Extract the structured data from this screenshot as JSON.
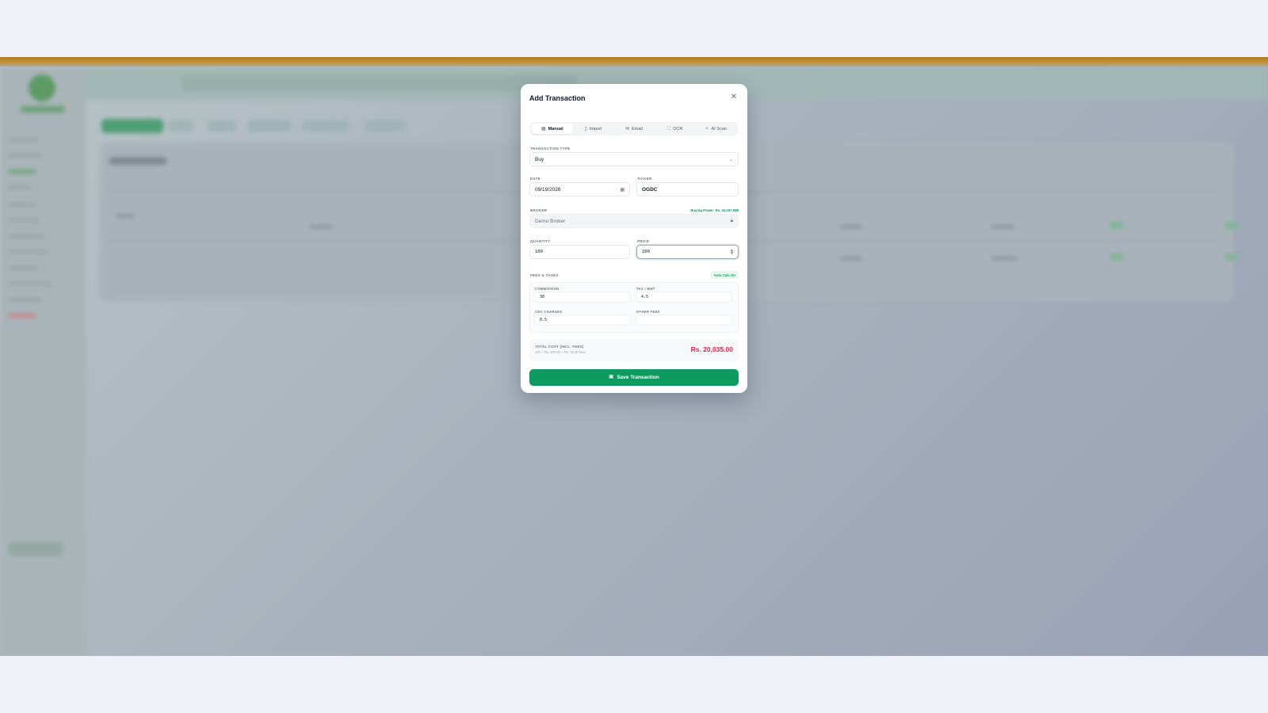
{
  "modal": {
    "title": "Add Transaction",
    "close_icon": "close-icon"
  },
  "tabs": [
    {
      "label": "Manual",
      "icon": "table-icon",
      "active": true
    },
    {
      "label": "Import",
      "icon": "file-icon",
      "active": false
    },
    {
      "label": "Email",
      "icon": "mail-icon",
      "active": false
    },
    {
      "label": "OCR",
      "icon": "scan-icon",
      "active": false
    },
    {
      "label": "AI Scan",
      "icon": "sparkle-icon",
      "active": false
    }
  ],
  "form": {
    "transaction_type": {
      "label": "TRANSACTION TYPE",
      "value": "Buy"
    },
    "date": {
      "label": "DATE",
      "value": "09/19/2026"
    },
    "ticker": {
      "label": "TICKER",
      "value": "OGDC"
    },
    "broker": {
      "label": "BROKER",
      "value": "Demo Broker",
      "buying_power": "Buying Power: Rs. 34,197,988"
    },
    "quantity": {
      "label": "QUANTITY",
      "value": "100"
    },
    "price": {
      "label": "PRICE",
      "value": "200"
    }
  },
  "fees": {
    "label": "FEES & TAXES",
    "auto_calc": "Auto Calc On",
    "commission": {
      "label": "COMMISSION",
      "value": "30"
    },
    "tax_wht": {
      "label": "TAX / WHT",
      "value": "4.5"
    },
    "cdc_charges": {
      "label": "CDC CHARGES",
      "value": "0.5"
    },
    "other_fees": {
      "label": "OTHER FEES",
      "value": ""
    }
  },
  "total": {
    "label": "TOTAL COST (INCL. FEES)",
    "breakdown": "100 × Rs. 200.00 + Rs. 35.00 fees",
    "value": "Rs. 20,035.00"
  },
  "save_button": {
    "label": "Save Transaction",
    "icon": "save-icon"
  },
  "colors": {
    "accent_green": "#0f9a62",
    "total_red": "#dc2645",
    "header_band": "#b07c22"
  }
}
